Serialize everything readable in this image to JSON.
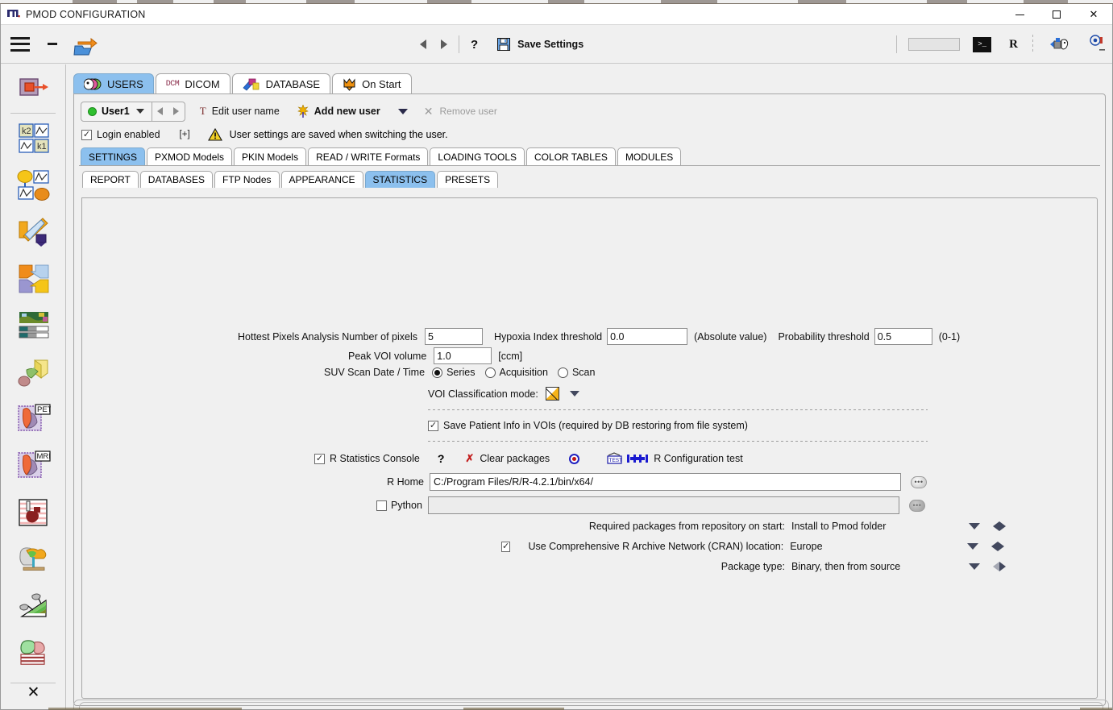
{
  "window": {
    "title": "PMOD CONFIGURATION",
    "app_icon": "pmod-logo-icon",
    "controls": {
      "minimize": "–",
      "maximize": "□",
      "close": "✕"
    }
  },
  "toolbar": {
    "menu_icon": "hamburger-menu-icon",
    "collapse_icon": "minus-icon",
    "open_icon": "open-folder-arrow-icon",
    "prev_label": "◀",
    "next_label": "▶",
    "help_label": "?",
    "save_icon": "floppy-disk-icon",
    "save_label": "Save Settings",
    "search_value": "",
    "terminal_icon": "terminal-icon",
    "terminal_glyph": ">_",
    "r_label": "R",
    "bug_icon": "bug-report-icon",
    "camera_icon": "screenshot-camera-icon"
  },
  "sidebar": {
    "items": [
      {
        "name": "sidebar-item-io",
        "icon": "data-transfer-icon"
      },
      {
        "name": "sidebar-item-kinetic",
        "icon": "k2-k1-kinetic-modeling-icon"
      },
      {
        "name": "sidebar-item-pkin",
        "icon": "pkin-compartment-icon"
      },
      {
        "name": "sidebar-item-pxmod",
        "icon": "pxmod-pixelwise-icon"
      },
      {
        "name": "sidebar-item-fusion",
        "icon": "fusion-arrows-icon"
      },
      {
        "name": "sidebar-item-view",
        "icon": "image-view-colortable-icon"
      },
      {
        "name": "sidebar-item-3d",
        "icon": "3d-rendering-icon"
      },
      {
        "name": "sidebar-item-pet-cardiac",
        "icon": "pet-cardiac-icon",
        "badge": "PET"
      },
      {
        "name": "sidebar-item-mri-cardiac",
        "icon": "mri-cardiac-icon",
        "badge": "MRI"
      },
      {
        "name": "sidebar-item-perfusion",
        "icon": "cardiac-perfusion-icon"
      },
      {
        "name": "sidebar-item-neuro",
        "icon": "brain-neuro-icon"
      },
      {
        "name": "sidebar-item-segmentation",
        "icon": "segmentation-icon"
      },
      {
        "name": "sidebar-item-atlas",
        "icon": "atlas-slices-icon"
      }
    ],
    "close_label": "✕",
    "close_icon": "close-x-icon"
  },
  "top_tabs": [
    {
      "label": "USERS",
      "icon": "users-icon",
      "active": true
    },
    {
      "label": "DICOM",
      "icon": "dcm-icon",
      "active": false
    },
    {
      "label": "DATABASE",
      "icon": "database-icon",
      "active": false
    },
    {
      "label": "On Start",
      "icon": "on-start-icon",
      "active": false
    }
  ],
  "user_row": {
    "selected_user": "User1",
    "status_dot_color": "#2fbf2f",
    "edit_user_label": "Edit user name",
    "edit_user_icon": "text-T-icon",
    "add_user_label": "Add new user",
    "add_user_icon": "add-user-sparkle-icon",
    "add_user_dropdown_icon": "chevron-down-icon",
    "remove_user_label": "Remove user",
    "remove_user_icon": "close-x-icon",
    "remove_user_disabled": true
  },
  "login_row": {
    "login_enabled_label": "Login enabled",
    "login_enabled_checked": true,
    "expand_label": "[+]",
    "warning_icon": "warning-triangle-icon",
    "warning_text": "User settings are saved when switching the user."
  },
  "tabs_level2": [
    {
      "label": "SETTINGS",
      "active": true
    },
    {
      "label": "PXMOD Models",
      "active": false
    },
    {
      "label": "PKIN Models",
      "active": false
    },
    {
      "label": "READ / WRITE Formats",
      "active": false
    },
    {
      "label": "LOADING TOOLS",
      "active": false
    },
    {
      "label": "COLOR TABLES",
      "active": false
    },
    {
      "label": "MODULES",
      "active": false
    }
  ],
  "tabs_level3": [
    {
      "label": "REPORT",
      "active": false
    },
    {
      "label": "DATABASES",
      "active": false
    },
    {
      "label": "FTP Nodes",
      "active": false
    },
    {
      "label": "APPEARANCE",
      "active": false
    },
    {
      "label": "STATISTICS",
      "active": true
    },
    {
      "label": "PRESETS",
      "active": false
    }
  ],
  "statistics": {
    "hottest_pixels_label": "Hottest Pixels Analysis Number of pixels",
    "hottest_pixels_value": "5",
    "hypoxia_label": "Hypoxia Index threshold",
    "hypoxia_value": "0.0",
    "hypoxia_note": "(Absolute value)",
    "probability_label": "Probability threshold",
    "probability_value": "0.5",
    "probability_note": "(0-1)",
    "peak_voi_label": "Peak VOI volume",
    "peak_voi_value": "1.0",
    "peak_voi_unit": "[ccm]",
    "suv_label": "SUV Scan Date / Time",
    "suv_options": [
      {
        "label": "Series",
        "selected": true
      },
      {
        "label": "Acquisition",
        "selected": false
      },
      {
        "label": "Scan",
        "selected": false
      }
    ],
    "voi_class_label": "VOI Classification mode:",
    "voi_class_swatch": "color-swatch-icon",
    "voi_class_dropdown": "chevron-down-icon",
    "save_patient_info_label": "Save Patient Info in VOIs (required by DB restoring from file system)",
    "save_patient_info_checked": true
  },
  "r_section": {
    "r_console_label": "R Statistics Console",
    "r_console_checked": true,
    "help_label": "?",
    "clear_packages_label": "Clear packages",
    "clear_packages_icon": "red-x-icon",
    "target_icon": "target-dot-icon",
    "test_icon": "test-tube-icon",
    "config_icon": "configuration-bar-icon",
    "r_config_test_label": "R Configuration test",
    "r_home_label": "R Home",
    "r_home_value": "C:/Program Files/R/R-4.2.1/bin/x64/",
    "r_home_browse_icon": "ellipsis-button-icon",
    "python_label": "Python",
    "python_checked": false,
    "python_value": "",
    "python_browse_icon": "ellipsis-button-icon",
    "rows": [
      {
        "label": "Required packages from repository on start:",
        "value": "Install to Pmod folder",
        "has_checkbox": false,
        "checked": false,
        "prev_disabled": false
      },
      {
        "label": "Use Comprehensive R Archive Network (CRAN) location:",
        "value": "Europe",
        "has_checkbox": true,
        "checked": true,
        "prev_disabled": false
      },
      {
        "label": "Package type:",
        "value": "Binary, then from source",
        "has_checkbox": false,
        "checked": false,
        "prev_disabled": true
      }
    ]
  },
  "colors": {
    "accent": "#8cc0ee",
    "window_bg": "#f0f0f0",
    "field_bg": "#ffffff",
    "status_green": "#2fbf2f",
    "red_x": "#c21b1b"
  }
}
